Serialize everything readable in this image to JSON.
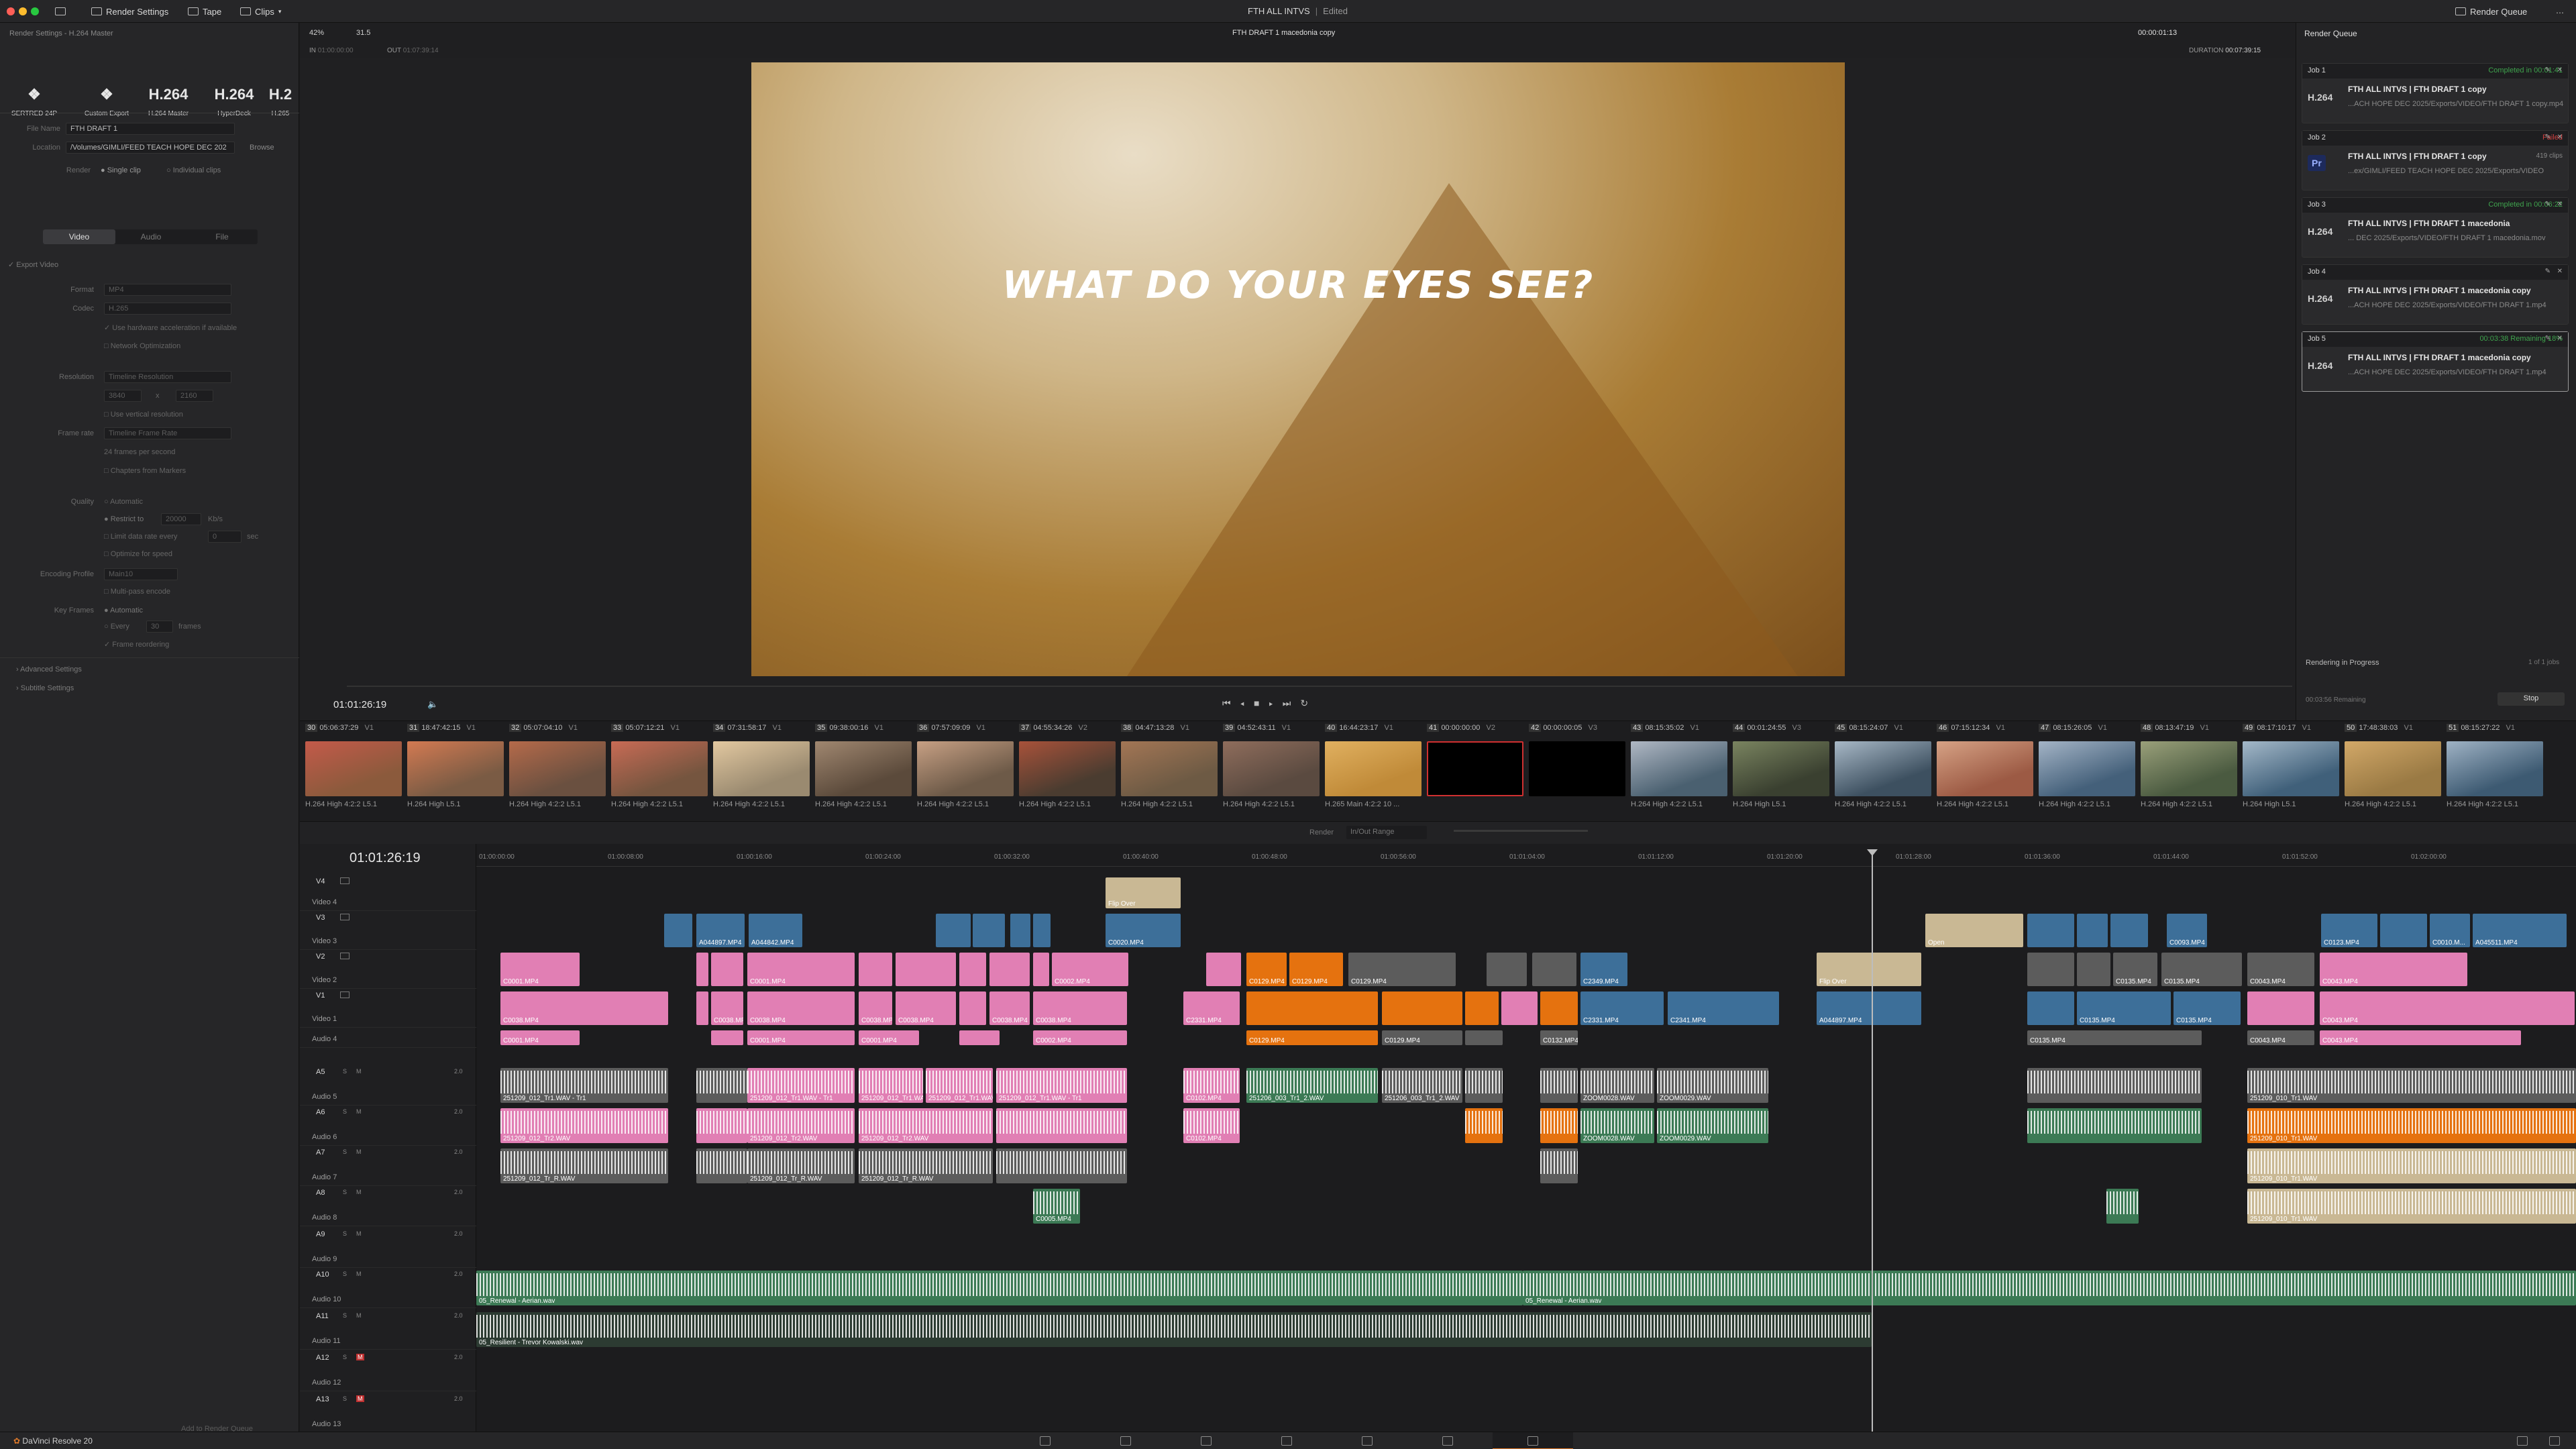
{
  "topbar": {
    "render_settings": "Render Settings",
    "tape": "Tape",
    "clips": "Clips",
    "project_title": "FTH ALL INTVS",
    "edited": "Edited",
    "render_queue": "Render Queue"
  },
  "viewer": {
    "zoom": "42%",
    "frame_rate": "31.5",
    "clip_name": "FTH DRAFT 1 macedonia copy",
    "timecode": "00:00:01:13",
    "in_label": "IN",
    "in_tc": "01:00:00:00",
    "out_label": "OUT",
    "out_tc": "01:07:39:14",
    "duration_label": "DURATION",
    "duration": "00:07:39:15",
    "overlay_text": "WHAT DO YOUR EYES SEE?",
    "playhead_tc": "01:01:26:19"
  },
  "render_settings": {
    "header": "Render Settings - H.264 Master",
    "presets": [
      {
        "icon": "❖",
        "label": "SERTRED 24P"
      },
      {
        "icon": "❖",
        "label": "Custom Export"
      },
      {
        "icon": "H.264",
        "label": "H.264 Master"
      },
      {
        "icon": "H.264",
        "label": "HyperDeck"
      },
      {
        "icon": "H.2",
        "label": "H.265"
      }
    ],
    "filename_label": "File Name",
    "filename": "FTH DRAFT 1",
    "location_label": "Location",
    "location": "/Volumes/GIMLI/FEED TEACH HOPE DEC 202",
    "browse": "Browse",
    "render_label": "Render",
    "single_clip": "Single clip",
    "individual_clips": "Individual clips",
    "tabs": [
      "Video",
      "Audio",
      "File"
    ],
    "export_video": "Export Video",
    "format_label": "Format",
    "format": "MP4",
    "codec_label": "Codec",
    "codec": "H.265",
    "hw_accel": "Use hardware acceleration if available",
    "network_opt": "Network Optimization",
    "resolution_label": "Resolution",
    "resolution": "Timeline Resolution",
    "res_w": "3840",
    "res_x": "x",
    "res_h": "2160",
    "vertical_res": "Use vertical resolution",
    "framerate_label": "Frame rate",
    "framerate": "Timeline Frame Rate",
    "fps_note": "24 frames per second",
    "chapters": "Chapters from Markers",
    "quality_label": "Quality",
    "automatic": "Automatic",
    "restrict_to": "Restrict to",
    "restrict_val": "20000",
    "kbps": "Kb/s",
    "limit_rate": "Limit data rate every",
    "limit_val": "0",
    "limit_unit": "sec",
    "optimize_speed": "Optimize for speed",
    "enc_profile_label": "Encoding Profile",
    "enc_profile": "Main10",
    "multipass": "Multi-pass encode",
    "keyframes_label": "Key Frames",
    "kf_auto": "Automatic",
    "kf_every": "Every",
    "kf_val": "30",
    "kf_unit": "frames",
    "frame_reorder": "Frame reordering",
    "advanced": "Advanced Settings",
    "subtitle": "Subtitle Settings",
    "add_queue": "Add to Render Queue"
  },
  "render_queue": {
    "title": "Render Queue",
    "jobs": [
      {
        "name": "Job 1",
        "status": "Completed in 00:01:41",
        "status_color": "#3fa34d",
        "badge": "H.264",
        "title": "FTH ALL INTVS | FTH DRAFT 1 copy",
        "path": "...ACH HOPE DEC 2025/Exports/VIDEO/FTH DRAFT 1 copy.mp4"
      },
      {
        "name": "Job 2",
        "status": "Failed",
        "status_color": "#d04040",
        "badge": "Pr",
        "title": "FTH ALL INTVS | FTH DRAFT 1 copy",
        "extra": "419 clips",
        "path": "...ex/GIMLI/FEED TEACH HOPE DEC 2025/Exports/VIDEO"
      },
      {
        "name": "Job 3",
        "status": "Completed in 00:06:22",
        "status_color": "#3fa34d",
        "badge": "H.264",
        "title": "FTH ALL INTVS | FTH DRAFT 1 macedonia",
        "path": "... DEC 2025/Exports/VIDEO/FTH DRAFT 1 macedonia.mov"
      },
      {
        "name": "Job 4",
        "status": "",
        "status_color": "#3fa34d",
        "badge": "H.264",
        "title": "FTH ALL INTVS | FTH DRAFT 1 macedonia copy",
        "path": "...ACH HOPE DEC 2025/Exports/VIDEO/FTH DRAFT 1.mp4"
      },
      {
        "name": "Job 5",
        "status": "00:03:38 Remaining",
        "status_pct": "18%",
        "status_color": "#3fa34d",
        "badge": "H.264",
        "title": "FTH ALL INTVS | FTH DRAFT 1 macedonia copy",
        "path": "...ACH HOPE DEC 2025/Exports/VIDEO/FTH DRAFT 1.mp4"
      }
    ],
    "progress": "Rendering in Progress",
    "remaining": "00:03:56 Remaining",
    "jobs_count": "1 of 1 jobs",
    "stop": "Stop"
  },
  "thumbs": [
    {
      "num": "30",
      "tc": "05:06:37:29",
      "trk": "V1",
      "cap": "H.264 High 4:2:2 L5.1"
    },
    {
      "num": "31",
      "tc": "18:47:42:15",
      "trk": "V1",
      "cap": "H.264 High L5.1"
    },
    {
      "num": "32",
      "tc": "05:07:04:10",
      "trk": "V1",
      "cap": "H.264 High 4:2:2 L5.1"
    },
    {
      "num": "33",
      "tc": "05:07:12:21",
      "trk": "V1",
      "cap": "H.264 High 4:2:2 L5.1"
    },
    {
      "num": "34",
      "tc": "07:31:58:17",
      "trk": "V1",
      "cap": "H.264 High 4:2:2 L5.1"
    },
    {
      "num": "35",
      "tc": "09:38:00:16",
      "trk": "V1",
      "cap": "H.264 High 4:2:2 L5.1"
    },
    {
      "num": "36",
      "tc": "07:57:09:09",
      "trk": "V1",
      "cap": "H.264 High 4:2:2 L5.1"
    },
    {
      "num": "37",
      "tc": "04:55:34:26",
      "trk": "V2",
      "cap": "H.264 High 4:2:2 L5.1"
    },
    {
      "num": "38",
      "tc": "04:47:13:28",
      "trk": "V1",
      "cap": "H.264 High 4:2:2 L5.1"
    },
    {
      "num": "39",
      "tc": "04:52:43:11",
      "trk": "V1",
      "cap": "H.264 High 4:2:2 L5.1"
    },
    {
      "num": "40",
      "tc": "16:44:23:17",
      "trk": "V1",
      "cap": "H.265 Main 4:2:2 10 ..."
    },
    {
      "num": "41",
      "tc": "00:00:00:00",
      "trk": "V2",
      "cap": ""
    },
    {
      "num": "42",
      "tc": "00:00:00:05",
      "trk": "V3",
      "cap": ""
    },
    {
      "num": "43",
      "tc": "08:15:35:02",
      "trk": "V1",
      "cap": "H.264 High 4:2:2 L5.1"
    },
    {
      "num": "44",
      "tc": "00:01:24:55",
      "trk": "V3",
      "cap": "H.264 High L5.1"
    },
    {
      "num": "45",
      "tc": "08:15:24:07",
      "trk": "V1",
      "cap": "H.264 High 4:2:2 L5.1"
    },
    {
      "num": "46",
      "tc": "07:15:12:34",
      "trk": "V1",
      "cap": "H.264 High 4:2:2 L5.1"
    },
    {
      "num": "47",
      "tc": "08:15:26:05",
      "trk": "V1",
      "cap": "H.264 High 4:2:2 L5.1"
    },
    {
      "num": "48",
      "tc": "08:13:47:19",
      "trk": "V1",
      "cap": "H.264 High 4:2:2 L5.1"
    },
    {
      "num": "49",
      "tc": "08:17:10:17",
      "trk": "V1",
      "cap": "H.264 High L5.1"
    },
    {
      "num": "50",
      "tc": "17:48:38:03",
      "trk": "V1",
      "cap": "H.264 High 4:2:2 L5.1"
    },
    {
      "num": "51",
      "tc": "08:15:27:22",
      "trk": "V1",
      "cap": "H.264 High 4:2:2 L5.1"
    }
  ],
  "timeline": {
    "timecode": "01:01:26:19",
    "render_label": "Render",
    "render_range": "In/Out Range",
    "ruler": [
      "01:00:00:00",
      "01:00:08:00",
      "01:00:16:00",
      "01:00:24:00",
      "01:00:32:00",
      "01:00:40:00",
      "01:00:48:00",
      "01:00:56:00",
      "01:01:04:00",
      "01:01:12:00",
      "01:01:20:00",
      "01:01:28:00",
      "01:01:36:00",
      "01:01:44:00",
      "01:01:52:00",
      "01:02:00:00"
    ],
    "tracks": [
      {
        "id": "V4",
        "name": "Video 4"
      },
      {
        "id": "V3",
        "name": "Video 3"
      },
      {
        "id": "V2",
        "name": "Video 2"
      },
      {
        "id": "V1",
        "name": "Video 1"
      },
      {
        "id": "",
        "name": "Audio 4"
      },
      {
        "id": "A5",
        "name": "Audio 5",
        "level": "2.0"
      },
      {
        "id": "A6",
        "name": "Audio 6",
        "level": "2.0"
      },
      {
        "id": "A7",
        "name": "Audio 7",
        "level": "2.0"
      },
      {
        "id": "A8",
        "name": "Audio 8",
        "level": "2.0"
      },
      {
        "id": "A9",
        "name": "Audio 9",
        "level": "2.0"
      },
      {
        "id": "A10",
        "name": "Audio 10",
        "level": "2.0"
      },
      {
        "id": "A11",
        "name": "Audio 11",
        "level": "2.0"
      },
      {
        "id": "A12",
        "name": "Audio 12",
        "level": "2.0"
      },
      {
        "id": "A13",
        "name": "Audio 13",
        "level": "2.0"
      }
    ],
    "clip_labels": {
      "c0001": "C0001.MP4",
      "c0038": "C0038.MP4",
      "a044": "A044897.MP4",
      "a0448": "A044842.MP4",
      "c0002": "C0002.MP4",
      "c0020": "C0020.MP4",
      "flip": "Flip Over",
      "c0129": "C0129.MP4",
      "c0132": "C0132.MP4",
      "c2349": "C2349.MP4",
      "c2331": "C2331.MP4",
      "c2341": "C2341.MP4",
      "c0043": "C0043.MP4",
      "c0135": "C0135.MP4",
      "c0093": "C0093.MP4",
      "c0123": "C0123.MP4",
      "a045": "A045511.MP4",
      "c0010": "C0010.M...",
      "c0005": "C0005.MP4",
      "c0102": "C0102.MP4",
      "w1": "251209_012_Tr1.WAV - Tr1",
      "w2": "251209_012_Tr2.WAV",
      "w3": "251209_012_Tr_R.WAV",
      "w4": "251206_003_Tr1_2.WAV",
      "w5": "ZOOM0028.WAV",
      "w6": "ZOOM0029.WAV",
      "w7": "251209_010_Tr1.WAV",
      "music1": "05_Renewal - Aerian.wav",
      "music2": "05_Renewal - Aerian.wav",
      "music3": "05_Resilient - Trevor Kowalski.wav",
      "open": "Open"
    }
  },
  "footer": {
    "app": "DaVinci Resolve 20"
  },
  "colors": {
    "pink": "#e17fb4",
    "blue": "#3d6f99",
    "orange": "#e5720f",
    "green": "#3c7a55",
    "tan": "#c9b894",
    "grey": "#5c5c5c"
  }
}
